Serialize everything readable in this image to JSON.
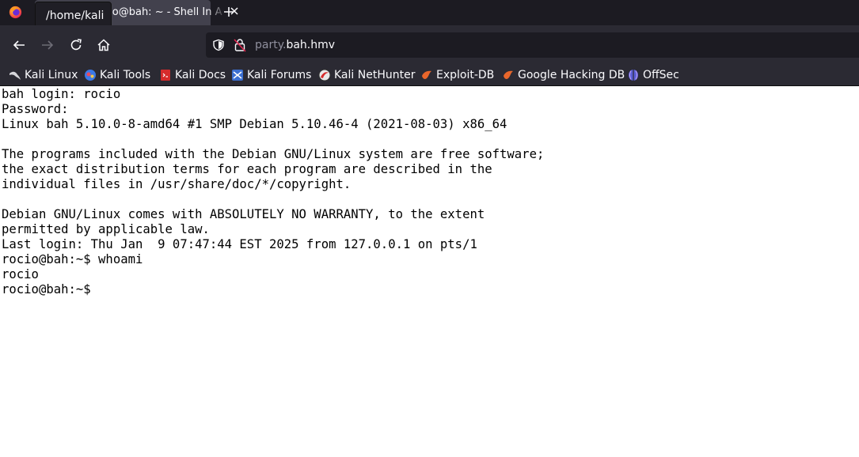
{
  "browser": {
    "tab": {
      "title": "rocio@bah: ~ - Shell In A Box",
      "tooltip": "/home/kali"
    },
    "url": {
      "subdomain": "party.",
      "domain": "bah.hmv"
    },
    "bookmarks": [
      {
        "label": "Kali Linux",
        "icon": "kali-dragon-icon"
      },
      {
        "label": "Kali Tools",
        "icon": "kali-tools-icon"
      },
      {
        "label": "Kali Docs",
        "icon": "kali-docs-icon"
      },
      {
        "label": "Kali Forums",
        "icon": "kali-forums-icon"
      },
      {
        "label": "Kali NetHunter",
        "icon": "nethunter-icon"
      },
      {
        "label": "Exploit-DB",
        "icon": "exploit-db-icon"
      },
      {
        "label": "Google Hacking DB",
        "icon": "ghdb-icon"
      },
      {
        "label": "OffSec",
        "icon": "offsec-icon"
      }
    ]
  },
  "terminal": {
    "lines": [
      "bah login: rocio",
      "Password:",
      "Linux bah 5.10.0-8-amd64 #1 SMP Debian 5.10.46-4 (2021-08-03) x86_64",
      "",
      "The programs included with the Debian GNU/Linux system are free software;",
      "the exact distribution terms for each program are described in the",
      "individual files in /usr/share/doc/*/copyright.",
      "",
      "Debian GNU/Linux comes with ABSOLUTELY NO WARRANTY, to the extent",
      "permitted by applicable law.",
      "Last login: Thu Jan  9 07:47:44 EST 2025 from 127.0.0.1 on pts/1",
      "rocio@bah:~$ whoami",
      "rocio",
      "rocio@bah:~$ "
    ]
  },
  "colors": {
    "tabbar_bg": "#1c1b22",
    "toolbar_bg": "#2b2a33",
    "terminal_bg": "#ffffff",
    "terminal_fg": "#000000"
  }
}
